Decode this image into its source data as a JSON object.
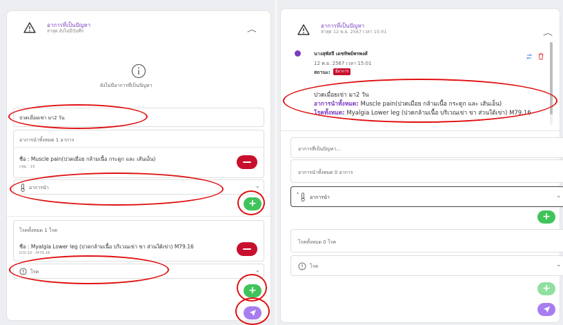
{
  "left": {
    "title": "อาการที่เป็นปัญหา",
    "subtitle": "ล่าสุด ยังไม่มีบันทึก",
    "empty_text": "ยังไม่มีอาการที่เป็นปัญหา",
    "complaint_value": "ปวดเมื่อยเข่า มา2 วัน",
    "symptoms_header": "อาการนำทั้งหมด 1 อาการ",
    "symptom_name": "ชื่อ : Muscle pain(ปวดเมื่อย กล้ามเนื้อ กระดูก และ เส้นเอ็น)",
    "symptom_group": "กลุ่ม : 19",
    "symptom_select_placeholder": "อาการนำ",
    "diag_header": "โรคทั้งหมด 1 โรค",
    "diag_name": "ชื่อ : Myalgia Lower leg (ปวดกล้ามเนื้อ บริเวณเข่า ขา ส่วนใต้เข่า) M79.16",
    "diag_code": "ICD-10 : M79.16",
    "diag_select_placeholder": "โรค"
  },
  "right": {
    "title": "อาการที่เป็นปัญหา",
    "subtitle": "ล่าสุด 12 พ.ย. 2567 เวลา 15:01",
    "author": "นางสุพัสจี เดชทิพย์พรพงศ์",
    "date": "12 พ.ย. 2567 เวลา 15:01",
    "status_label": "สถานะ:",
    "status_badge": "มีอาการ",
    "note_line1": "ปวดเมื่อยเข่า มา2 วัน",
    "symptoms_prefix": "อาการนำทั้งหมด:",
    "symptoms_value": " Muscle pain(ปวดเมื่อย กล้ามเนื้อ กระดูก และ เส้นเอ็น)",
    "diseases_prefix": "โรคทั้งหมด:",
    "diseases_value": " Myalgia Lower leg (ปวดกล้ามเนื้อ บริเวณเข่า ขา ส่วนใต้เข่า) M79.16",
    "complaint_placeholder": "อาการที่เป็นปัญหา...",
    "symptoms_header": "อาการนำทั้งหมด 0 อาการ",
    "symptom_select_placeholder": "อาการนำ",
    "diag_header": "โรคทั้งหมด 0 โรค",
    "diag_select_placeholder": "โรค"
  },
  "colors": {
    "accent_purple": "#7a3dbf",
    "remove_red": "#c8102e",
    "add_green": "#3fc45a",
    "send_purple": "#a77df0",
    "annotation_red": "#e01010"
  }
}
